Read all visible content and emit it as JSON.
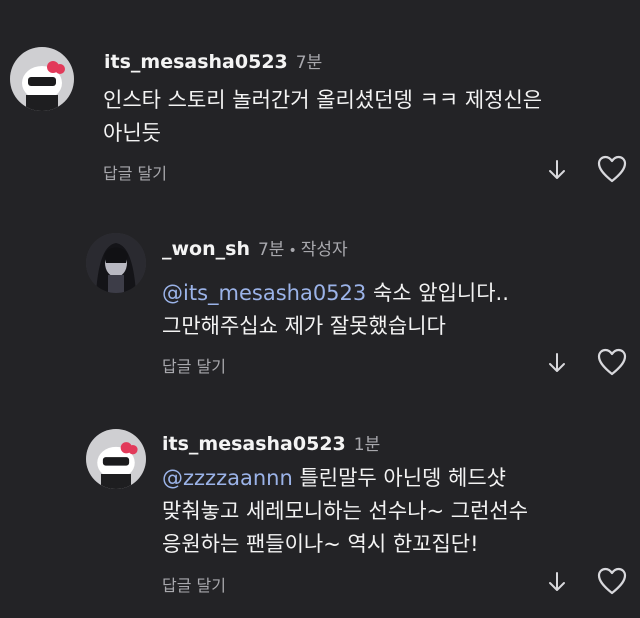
{
  "comments": [
    {
      "username": "its_mesasha0523",
      "time": "7분",
      "lines": [
        "인스타 스토리 놀러간거 올리셨던뎅 ㅋㅋ 제정신은",
        "아닌듯"
      ],
      "reply_label": "답글 달기",
      "icons": {
        "avatar": "hello-kitty-avatar",
        "down": "down-arrow-icon",
        "like": "heart-icon"
      }
    },
    {
      "username": "_won_sh",
      "time": "7분",
      "separator": "•",
      "author_badge": "작성자",
      "mention": "@its_mesasha0523",
      "line1_rest": " 숙소 앞입니다..",
      "line2": "그만해주십쇼 제가 잘못했습니다",
      "reply_label": "답글 달기",
      "icons": {
        "avatar": "dark-character-avatar",
        "down": "down-arrow-icon",
        "like": "heart-icon"
      }
    },
    {
      "username": "its_mesasha0523",
      "time": "1분",
      "mention": "@zzzzaannn",
      "line1_rest": " 틀린말두 아닌뎅 헤드샷",
      "line2": "맞춰놓고 세레모니하는 선수나~ 그런선수",
      "line3": "응원하는 팬들이나~ 역시 한꼬집단!",
      "reply_label": "답글 달기",
      "icons": {
        "avatar": "hello-kitty-avatar",
        "down": "down-arrow-icon",
        "like": "heart-icon"
      }
    }
  ],
  "colors": {
    "background": "#232326",
    "mention": "#9bb3e8",
    "muted": "#a8a8ad"
  }
}
